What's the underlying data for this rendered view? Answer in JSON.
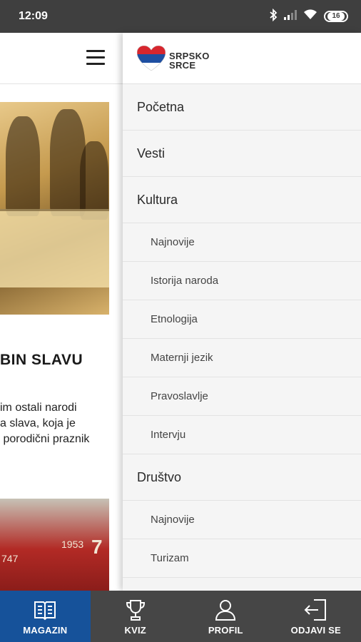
{
  "status_bar": {
    "time": "12:09",
    "battery_level": "16"
  },
  "article": {
    "title_fragment": "BIN SLAVU",
    "excerpt_lines": [
      "im ostali narodi",
      "a slava, koja je",
      " porodični praznik"
    ],
    "image2_years": [
      "1953",
      "747",
      "7"
    ]
  },
  "drawer": {
    "logo_line1": "SRPSKO",
    "logo_line2": "SRCE",
    "menu": [
      {
        "label": "Početna",
        "level": "top"
      },
      {
        "label": "Vesti",
        "level": "top"
      },
      {
        "label": "Kultura",
        "level": "top"
      },
      {
        "label": "Najnovije",
        "level": "sub"
      },
      {
        "label": "Istorija naroda",
        "level": "sub"
      },
      {
        "label": "Etnologija",
        "level": "sub"
      },
      {
        "label": "Maternji jezik",
        "level": "sub"
      },
      {
        "label": "Pravoslavlje",
        "level": "sub"
      },
      {
        "label": "Intervju",
        "level": "sub"
      },
      {
        "label": "Društvo",
        "level": "top"
      },
      {
        "label": "Najnovije",
        "level": "sub"
      },
      {
        "label": "Turizam",
        "level": "sub"
      }
    ]
  },
  "bottom_nav": {
    "tabs": [
      {
        "label": "MAGAZIN",
        "icon": "book-icon",
        "active": true
      },
      {
        "label": "KVIZ",
        "icon": "trophy-icon",
        "active": false
      },
      {
        "label": "PROFIL",
        "icon": "user-icon",
        "active": false
      },
      {
        "label": "ODJAVI SE",
        "icon": "logout-icon",
        "active": false
      }
    ]
  },
  "colors": {
    "status_bar": "#3f3f3f",
    "nav_bar": "#464646",
    "nav_active": "#16529a",
    "drawer_bg": "#f4f4f4"
  }
}
